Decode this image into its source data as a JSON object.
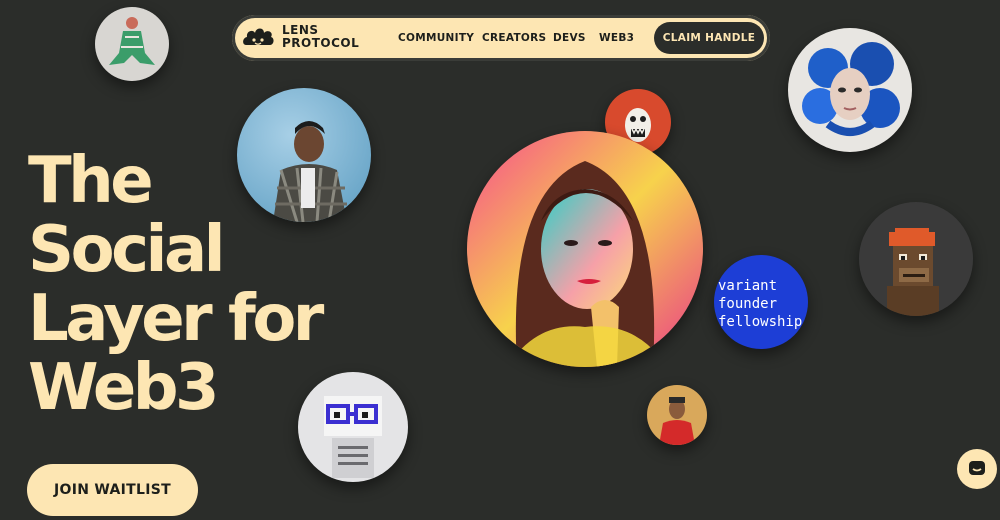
{
  "nav": {
    "logo_line1": "LENS",
    "logo_line2": "PROTOCOL",
    "links": [
      "COMMUNITY",
      "CREATORS",
      "DEVS",
      "WEB3"
    ],
    "cta": "CLAIM HANDLE"
  },
  "hero": {
    "line1": "The",
    "line2": "Social",
    "line3": "Layer for",
    "line4": "Web3"
  },
  "join_button": "JOIN WAITLIST",
  "badge": {
    "line1": "variant",
    "line2": "founder",
    "line3": "fellowship"
  },
  "colors": {
    "background": "#2b2d2a",
    "accent": "#fde6b3",
    "text_dark": "#1d1f1b"
  },
  "icons": {
    "logo": "lens-cloud-logo",
    "chat": "chat-bubble-icon"
  }
}
